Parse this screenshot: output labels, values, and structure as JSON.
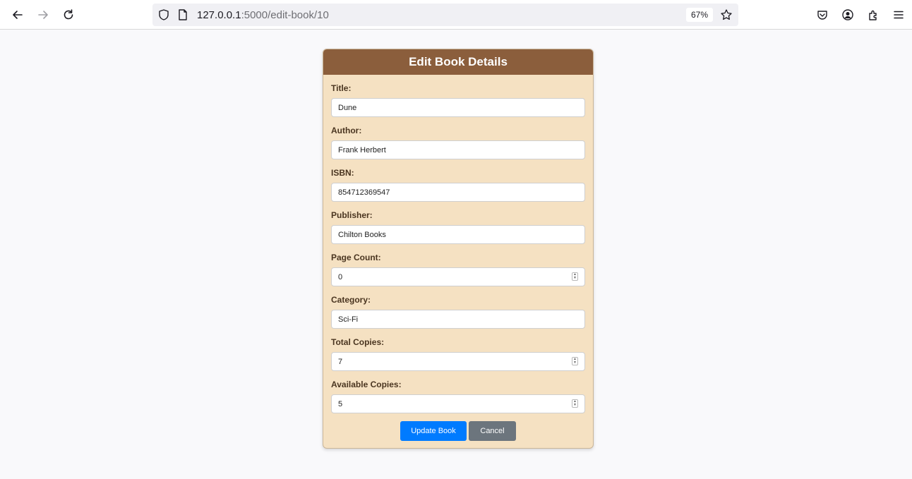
{
  "browser": {
    "url_host": "127.0.0.1",
    "url_path": ":5000/edit-book/10",
    "zoom": "67%"
  },
  "form": {
    "title": "Edit Book Details",
    "fields": {
      "title": {
        "label": "Title:",
        "value": "Dune"
      },
      "author": {
        "label": "Author:",
        "value": "Frank Herbert"
      },
      "isbn": {
        "label": "ISBN:",
        "value": "854712369547"
      },
      "publisher": {
        "label": "Publisher:",
        "value": "Chilton Books"
      },
      "page_count": {
        "label": "Page Count:",
        "value": "0"
      },
      "category": {
        "label": "Category:",
        "value": "Sci-Fi"
      },
      "total_copies": {
        "label": "Total Copies:",
        "value": "7"
      },
      "available_copies": {
        "label": "Available Copies:",
        "value": "5"
      }
    },
    "update_label": "Update Book",
    "cancel_label": "Cancel"
  },
  "colors": {
    "header": "#8b5e3c",
    "card": "#f5e1c2",
    "primary": "#007bff",
    "secondary": "#6c757d"
  }
}
